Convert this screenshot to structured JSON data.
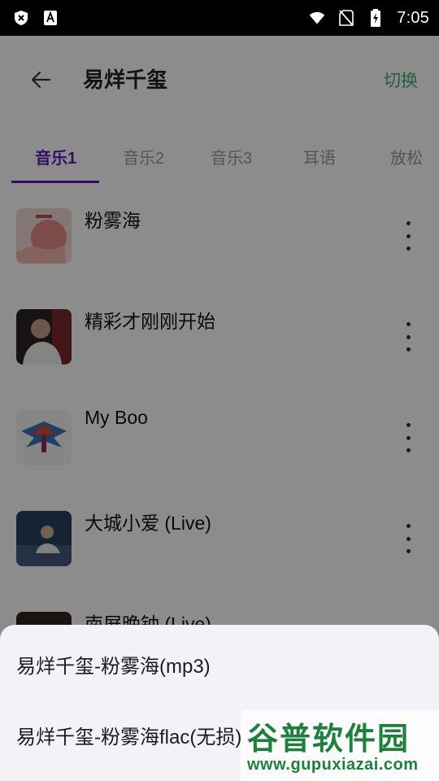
{
  "status_bar": {
    "time": "7:05",
    "icons": [
      "shield-x-icon",
      "font-a-icon",
      "wifi-icon",
      "no-sim-icon",
      "battery-charging-icon"
    ]
  },
  "header": {
    "back_icon": "arrow-left-icon",
    "title": "易烊千玺",
    "switch_label": "切换"
  },
  "tabs": [
    {
      "label": "音乐1",
      "active": true
    },
    {
      "label": "音乐2",
      "active": false
    },
    {
      "label": "音乐3",
      "active": false
    },
    {
      "label": "耳语",
      "active": false
    },
    {
      "label": "放松",
      "active": false
    }
  ],
  "songs": [
    {
      "title": "粉雾海"
    },
    {
      "title": "精彩才刚刚开始"
    },
    {
      "title": "My Boo"
    },
    {
      "title": "大城小爱 (Live)"
    },
    {
      "title": "南屏晚钟 (Live)"
    }
  ],
  "bottom_sheet": {
    "items": [
      {
        "label": "易烊千玺-粉雾海(mp3)"
      },
      {
        "label": "易烊千玺-粉雾海flac(无损)"
      }
    ]
  },
  "watermark": {
    "brand": "谷普软件园",
    "url": "www.gupuxiazai.com"
  },
  "colors": {
    "accent": "#5b1bbd",
    "switch": "#3fae77",
    "watermark": "#1f7f3c"
  }
}
